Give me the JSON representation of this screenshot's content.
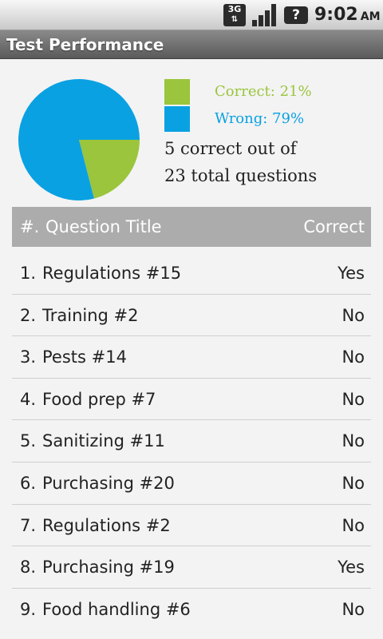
{
  "status_bar": {
    "network": "3G",
    "time": "9:02",
    "ampm": "AM"
  },
  "app": {
    "title": "Test Performance"
  },
  "summary": {
    "correct_label": "Correct: 21%",
    "wrong_label": "Wrong: 79%",
    "line1": "5 correct out of",
    "line2": "23 total questions",
    "correct_color": "#9ac53c",
    "wrong_color": "#0aa1e2"
  },
  "chart_data": {
    "type": "pie",
    "slices": [
      {
        "label": "Correct",
        "value": 21,
        "color": "#9ac53c"
      },
      {
        "label": "Wrong",
        "value": 79,
        "color": "#0aa1e2"
      }
    ]
  },
  "table": {
    "headers": {
      "num": "#.",
      "title": "Question Title",
      "correct": "Correct"
    },
    "rows": [
      {
        "num": "1.",
        "title": "Regulations #15",
        "correct": "Yes"
      },
      {
        "num": "2.",
        "title": "Training #2",
        "correct": "No"
      },
      {
        "num": "3.",
        "title": "Pests #14",
        "correct": "No"
      },
      {
        "num": "4.",
        "title": "Food prep #7",
        "correct": "No"
      },
      {
        "num": "5.",
        "title": "Sanitizing #11",
        "correct": "No"
      },
      {
        "num": "6.",
        "title": "Purchasing #20",
        "correct": "No"
      },
      {
        "num": "7.",
        "title": "Regulations #2",
        "correct": "No"
      },
      {
        "num": "8.",
        "title": "Purchasing #19",
        "correct": "Yes"
      },
      {
        "num": "9.",
        "title": "Food handling #6",
        "correct": "No"
      }
    ]
  }
}
